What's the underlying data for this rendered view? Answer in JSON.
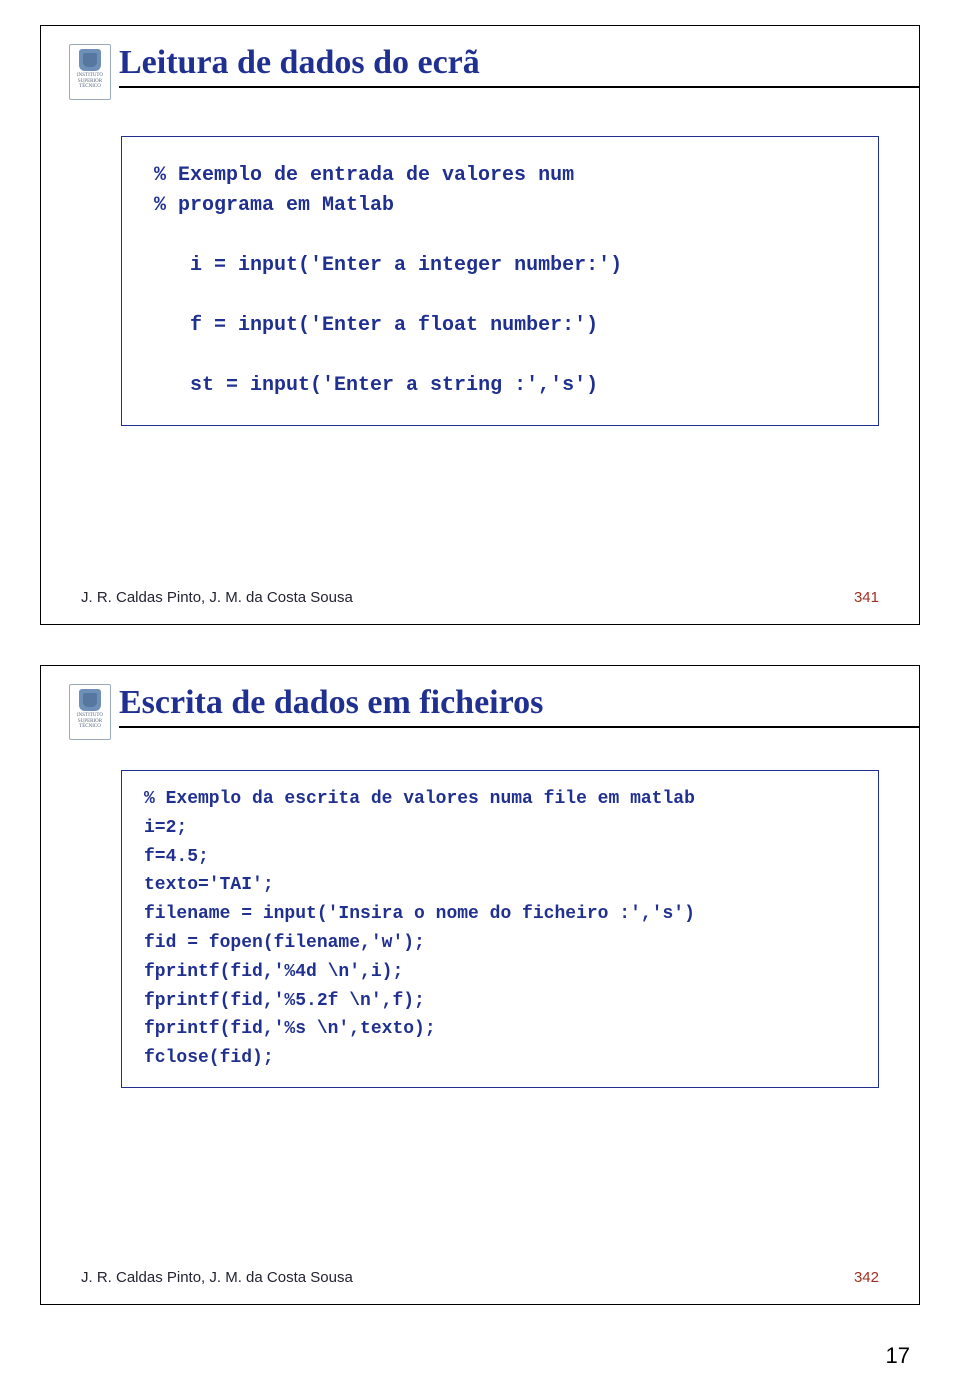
{
  "logo": {
    "line1": "INSTITUTO",
    "line2": "SUPERIOR",
    "line3": "TÉCNICO"
  },
  "slide1": {
    "title": "Leitura de dados do ecrã",
    "code": "% Exemplo de entrada de valores num\n% programa em Matlab\n\n   i = input('Enter a integer number:')\n\n   f = input('Enter a float number:')\n\n   st = input('Enter a string :','s')",
    "footer_author": "J. R. Caldas Pinto, J. M. da Costa Sousa",
    "footer_num": "341"
  },
  "slide2": {
    "title": "Escrita de dados em ficheiros",
    "code": "% Exemplo da escrita de valores numa file em matlab\ni=2;\nf=4.5;\ntexto='TAI';\nfilename = input('Insira o nome do ficheiro :','s')\nfid = fopen(filename,'w');\nfprintf(fid,'%4d \\n',i);\nfprintf(fid,'%5.2f \\n',f);\nfprintf(fid,'%s \\n',texto);\nfclose(fid);",
    "footer_author": "J. R. Caldas Pinto, J. M. da Costa Sousa",
    "footer_num": "342"
  },
  "outer_page_num": "17"
}
